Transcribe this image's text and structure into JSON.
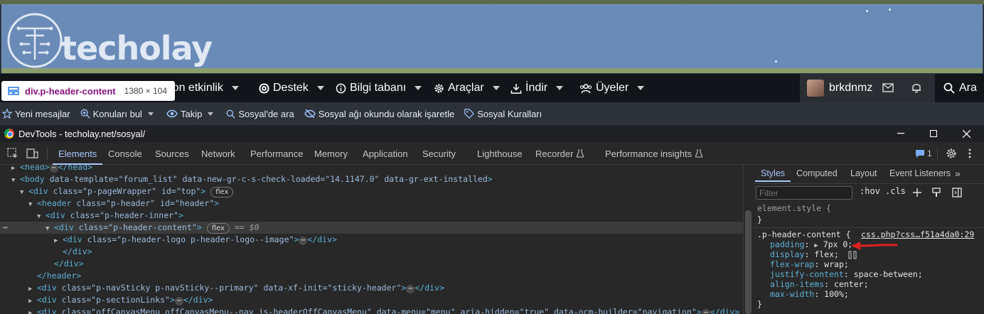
{
  "site": {
    "logo_text": "techolay",
    "tooltip": {
      "element": "div.p-header-content",
      "size": "1380 × 104"
    },
    "nav": [
      {
        "label": "Son etkinlik"
      },
      {
        "label": "Destek"
      },
      {
        "label": "Bilgi tabanı"
      },
      {
        "label": "Araçlar"
      },
      {
        "label": "İndir"
      },
      {
        "label": "Üyeler"
      }
    ],
    "user": {
      "name": "brkdnmz"
    },
    "search_label": "Ara",
    "subnav": [
      {
        "label": "Yeni mesajlar",
        "icon": "star-icon"
      },
      {
        "label": "Konuları bul",
        "icon": "search-plus-icon"
      },
      {
        "label": "Takip",
        "icon": "eye-icon"
      },
      {
        "label": "Sosyal'de ara",
        "icon": "search-icon"
      },
      {
        "label": "Sosyal ağı okundu olarak işaretle",
        "icon": "eye-slash-icon"
      },
      {
        "label": "Sosyal Kuralları",
        "icon": "tag-icon"
      }
    ]
  },
  "devtools": {
    "window_title": "DevTools - techolay.net/sosyal/",
    "tabs": [
      "Elements",
      "Console",
      "Sources",
      "Network",
      "Performance",
      "Memory",
      "Application",
      "Security",
      "Lighthouse",
      "Recorder",
      "Performance insights"
    ],
    "active_tab": "Elements",
    "issues_count": "1",
    "dom": {
      "head": {
        "tag": "<head>",
        "close": "</head>"
      },
      "body": {
        "open": "<body",
        "attrs": "data-template=\"forum_list\" data-new-gr-c-s-check-loaded=\"14.1147.0\" data-gr-ext-installed",
        "close": ">"
      },
      "pageWrapper": {
        "open": "<div",
        "attrs": "class=\"p-pageWrapper\" id=\"top\"",
        "close": ">",
        "badge": "flex"
      },
      "header": {
        "open": "<header",
        "attrs": "class=\"p-header\" id=\"header\"",
        "close": ">"
      },
      "headerInner": {
        "open": "<div",
        "attrs": "class=\"p-header-inner\"",
        "close": ">"
      },
      "headerContent": {
        "open": "<div",
        "attrs": "class=\"p-header-content\"",
        "close": ">",
        "badge": "flex",
        "eq": "== $0"
      },
      "headerLogo": {
        "open": "<div",
        "attrs": "class=\"p-header-logo p-header-logo--image\"",
        "close": ">",
        "end": "</div>"
      },
      "closeDiv1": "</div>",
      "closeDiv2": "</div>",
      "closeHeader": "</header>",
      "navSticky": {
        "open": "<div",
        "attrs": "class=\"p-navSticky p-navSticky--primary\" data-xf-init=\"sticky-header\"",
        "close": ">",
        "end": "</div>"
      },
      "sectionLinks": {
        "open": "<div",
        "attrs": "class=\"p-sectionLinks\"",
        "close": ">",
        "end": "</div>"
      },
      "offCanvas": {
        "open": "<div",
        "attrs": "class=\"offCanvasMenu offCanvasMenu--nav js-headerOffCanvasMenu\" data-menu=\"menu\" aria-hidden=\"true\" data-ocm-builder=\"navigation\"",
        "close": ">",
        "end": "</div>"
      }
    },
    "styles_tabs": [
      "Styles",
      "Computed",
      "Layout",
      "Event Listeners"
    ],
    "filter_placeholder": "Filter",
    "hov": ":hov",
    "cls": ".cls",
    "element_style": "element.style {",
    "close_brace": "}",
    "rule": {
      "selector": ".p-header-content {",
      "source": "css.php?css…f51a4da0:29",
      "declarations": [
        {
          "prop": "padding",
          "value": "7px 0;"
        },
        {
          "prop": "display",
          "value": "flex;"
        },
        {
          "prop": "flex-wrap",
          "value": "wrap;"
        },
        {
          "prop": "justify-content",
          "value": "space-between;"
        },
        {
          "prop": "align-items",
          "value": "center;"
        },
        {
          "prop": "max-width",
          "value": "100%;"
        }
      ]
    }
  },
  "colors": {
    "accent": "#a8c7fa",
    "annotation_arrow": "#e02020"
  }
}
